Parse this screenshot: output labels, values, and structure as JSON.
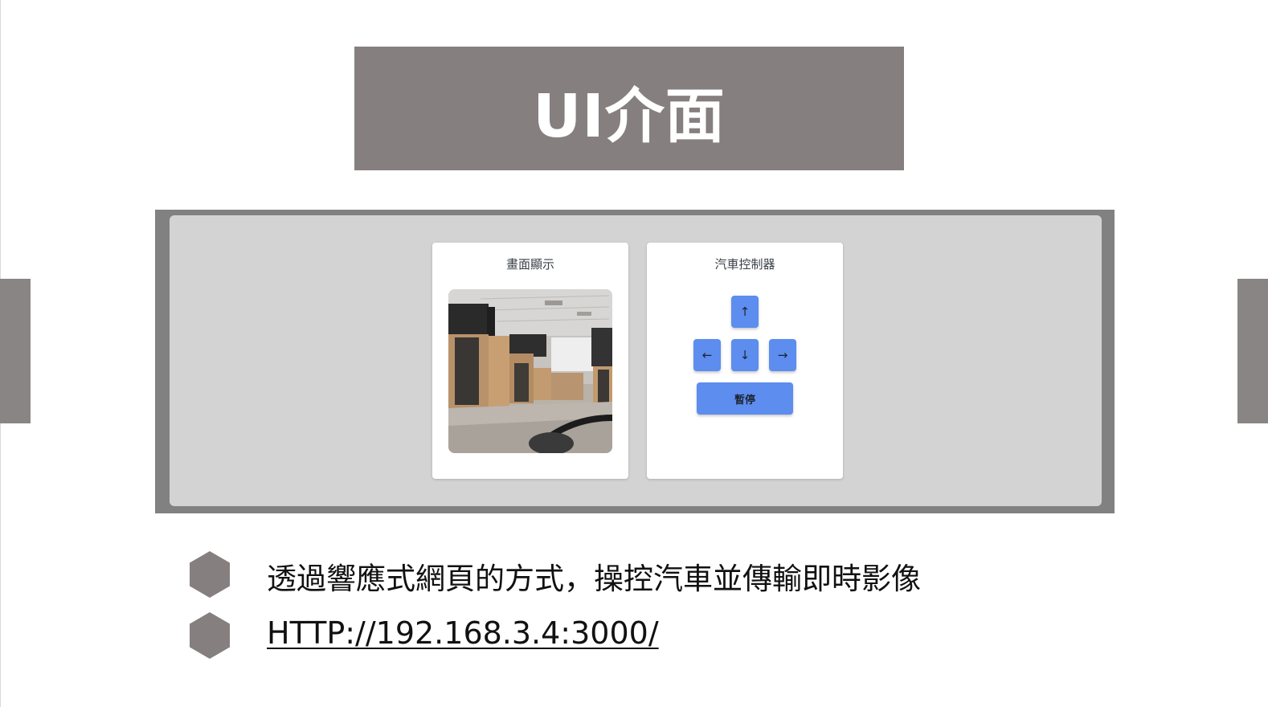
{
  "slide": {
    "title": "UI介面",
    "bullets": [
      "透過響應式網頁的方式，操控汽車並傳輸即時影像",
      "HTTP://192.168.3.4:3000/"
    ]
  },
  "app": {
    "camera_card": {
      "title": "畫面顯示"
    },
    "control_card": {
      "title": "汽車控制器",
      "up_glyph": "↑",
      "left_glyph": "←",
      "down_glyph": "↓",
      "right_glyph": "→",
      "stop_label": "暫停"
    }
  },
  "icons": {
    "up": "arrow-up-icon",
    "left": "arrow-left-icon",
    "down": "arrow-down-icon",
    "right": "arrow-right-icon",
    "bullet": "hexagon-bullet-icon"
  },
  "colors": {
    "banner": "#867f7f",
    "frame": "#818181",
    "panel": "#d3d3d3",
    "button": "#5c8def",
    "bullet": "#867f7f"
  }
}
